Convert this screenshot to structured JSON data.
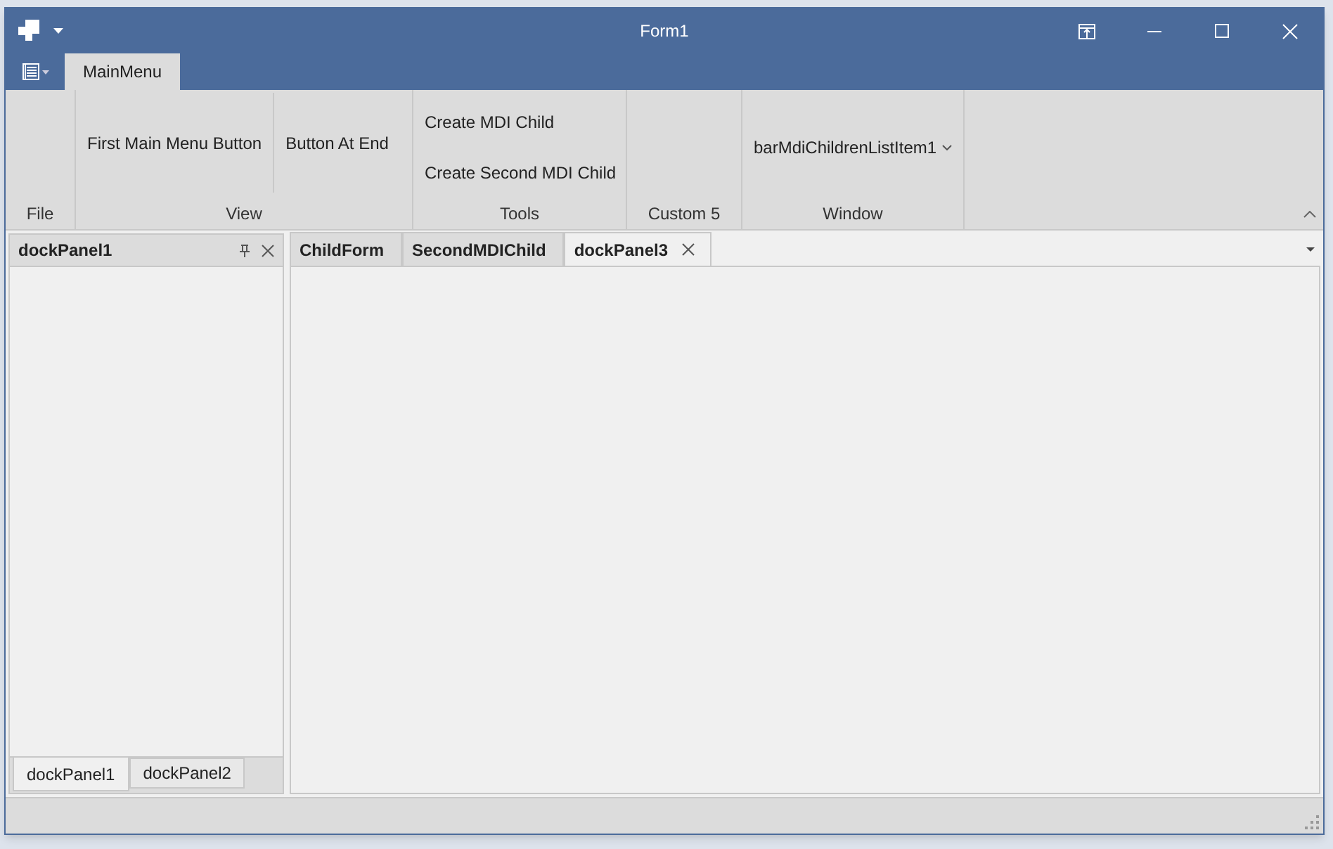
{
  "window": {
    "title": "Form1"
  },
  "ribbon": {
    "tabs": [
      {
        "label": "MainMenu",
        "selected": true
      }
    ],
    "groups": [
      {
        "label": "File"
      },
      {
        "label": "View",
        "items": [
          {
            "kind": "large",
            "label": "First Main Menu Button"
          },
          {
            "kind": "large",
            "label": "Button At End"
          }
        ]
      },
      {
        "label": "Tools",
        "items": [
          {
            "kind": "small",
            "label": "Create MDI Child"
          },
          {
            "kind": "small",
            "label": "Create Second MDI Child"
          }
        ]
      },
      {
        "label": "Custom 5"
      },
      {
        "label": "Window",
        "items": [
          {
            "kind": "dropdown",
            "label": "barMdiChildrenListItem1"
          }
        ]
      }
    ]
  },
  "dock_panel": {
    "title": "dockPanel1",
    "tabs": [
      {
        "label": "dockPanel1",
        "selected": true
      },
      {
        "label": "dockPanel2",
        "selected": false
      }
    ]
  },
  "documents": {
    "tabs": [
      {
        "label": "ChildForm",
        "selected": false
      },
      {
        "label": "SecondMDIChild",
        "selected": false
      },
      {
        "label": "dockPanel3",
        "selected": true
      }
    ]
  }
}
